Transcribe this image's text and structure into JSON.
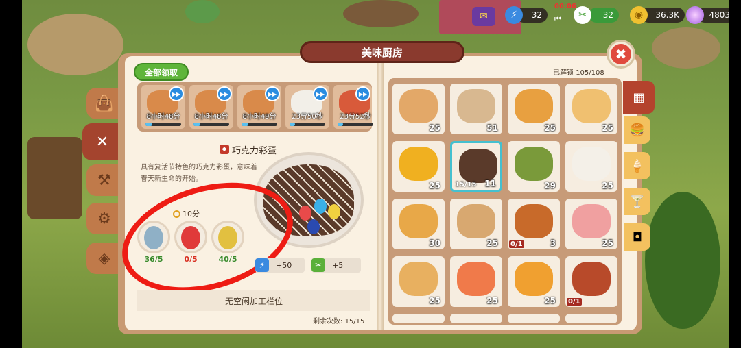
{
  "hud": {
    "energy_value": "32",
    "tools_value": "32",
    "status_time": "00:06",
    "coins_value": "36.3K",
    "gems_value": "4803"
  },
  "window": {
    "title": "美味厨房",
    "unlocked_label": "已解锁",
    "unlocked_value": "105/108"
  },
  "left": {
    "collect_all": "全部领取",
    "queue": [
      {
        "time": "8小时48分",
        "progress": 0.2,
        "color": "#d98a4a"
      },
      {
        "time": "8小时48分",
        "progress": 0.2,
        "color": "#d98a4a"
      },
      {
        "time": "8小时49分",
        "progress": 0.2,
        "color": "#d98a4a"
      },
      {
        "time": "23分50秒",
        "progress": 0.15,
        "color": "#f2efe8"
      },
      {
        "time": "23分52秒",
        "progress": 0.15,
        "color": "#d85a3a"
      }
    ],
    "recipe_name": "巧克力彩蛋",
    "description": "具有复活节特色的巧克力彩蛋，意味着春天新生命的开始。",
    "cook_time": "10分",
    "ingredients": [
      {
        "count": "36/5",
        "color": "#8fb0c6",
        "count_color": "#3a8a2a"
      },
      {
        "count": "0/5",
        "color": "#e03a3a",
        "count_color": "#d83020"
      },
      {
        "count": "40/5",
        "color": "#e2c040",
        "count_color": "#3a8a2a"
      }
    ],
    "rewards": [
      {
        "value": "+50",
        "icon": "lightning-icon"
      },
      {
        "value": "+5",
        "icon": "utensils-icon"
      }
    ],
    "no_slot": "无空闲加工栏位",
    "remaining_label": "剩余次数:",
    "remaining_value": "15/15"
  },
  "grid": [
    {
      "count": "25",
      "color": "#e3a868"
    },
    {
      "count": "51",
      "color": "#d8b890"
    },
    {
      "count": "25",
      "color": "#e8a040"
    },
    {
      "count": "25",
      "color": "#f0c070"
    },
    {
      "count": "25",
      "color": "#f0b020"
    },
    {
      "count": "11",
      "color": "#5a3a2a",
      "frac": "15/15",
      "selected": true
    },
    {
      "count": "29",
      "color": "#7a9a3a"
    },
    {
      "count": "25",
      "color": "#f4f0e8"
    },
    {
      "count": "30",
      "color": "#e8a848"
    },
    {
      "count": "25",
      "color": "#d8a870"
    },
    {
      "count": "3",
      "color": "#c86a2a",
      "frac": "0/1"
    },
    {
      "count": "25",
      "color": "#f0a0a0"
    },
    {
      "count": "25",
      "color": "#e8b060"
    },
    {
      "count": "25",
      "color": "#f07a4a"
    },
    {
      "count": "25",
      "color": "#f0a030"
    },
    {
      "count": "",
      "color": "#b84a2a",
      "frac": "0/1"
    }
  ],
  "side_tabs": [
    "bag-icon",
    "utensils-icon",
    "anvil-icon",
    "gear-icon",
    "candy-icon"
  ],
  "right_tabs": [
    "grid-icon",
    "burger-icon",
    "ice-cream-icon",
    "cocktail-icon",
    "jar-icon"
  ]
}
